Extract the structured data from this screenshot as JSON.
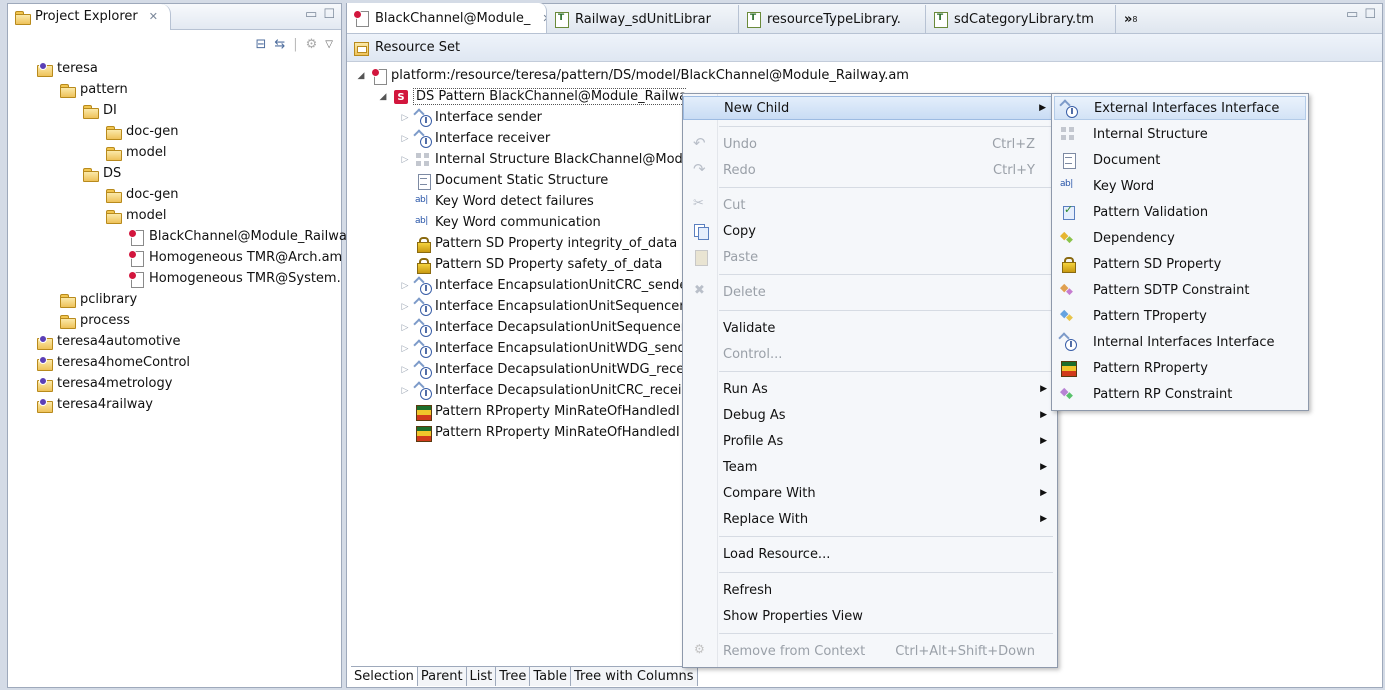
{
  "explorer": {
    "title": "Project Explorer",
    "tree": [
      {
        "label": "teresa",
        "icon": "project-icon",
        "depth": 0
      },
      {
        "label": "pattern",
        "icon": "folder-icon",
        "depth": 1
      },
      {
        "label": "DI",
        "icon": "folder-icon",
        "depth": 2
      },
      {
        "label": "doc-gen",
        "icon": "folder-icon",
        "depth": 3
      },
      {
        "label": "model",
        "icon": "folder-icon",
        "depth": 3
      },
      {
        "label": "DS",
        "icon": "folder-icon",
        "depth": 2
      },
      {
        "label": "doc-gen",
        "icon": "folder-icon",
        "depth": 3
      },
      {
        "label": "model",
        "icon": "folder-icon",
        "depth": 3
      },
      {
        "label": "BlackChannel@Module_Railwa",
        "icon": "model-file-icon",
        "depth": 4
      },
      {
        "label": "Homogeneous TMR@Arch.am",
        "icon": "model-file-icon",
        "depth": 4
      },
      {
        "label": "Homogeneous TMR@System.",
        "icon": "model-file-icon",
        "depth": 4
      },
      {
        "label": "pclibrary",
        "icon": "folder-icon",
        "depth": 1
      },
      {
        "label": "process",
        "icon": "folder-icon",
        "depth": 1
      },
      {
        "label": "teresa4automotive",
        "icon": "project-icon",
        "depth": 0
      },
      {
        "label": "teresa4homeControl",
        "icon": "project-icon",
        "depth": 0
      },
      {
        "label": "teresa4metrology",
        "icon": "project-icon",
        "depth": 0
      },
      {
        "label": "teresa4railway",
        "icon": "project-icon",
        "depth": 0
      }
    ]
  },
  "editor": {
    "tabs": [
      {
        "label": "BlackChannel@Module_",
        "active": true
      },
      {
        "label": "Railway_sdUnitLibrar",
        "active": false
      },
      {
        "label": "resourceTypeLibrary.",
        "active": false
      },
      {
        "label": "sdCategoryLibrary.tm",
        "active": false
      }
    ],
    "overflow_label": "»",
    "overflow_count": "8",
    "header": "Resource Set",
    "root": "platform:/resource/teresa/pattern/DS/model/BlackChannel@Module_Railway.am",
    "pattern": "DS Pattern BlackChannel@Module_Railwa",
    "items": [
      {
        "label": "Interface sender",
        "icon": "interface-icon",
        "expand": true
      },
      {
        "label": "Interface receiver",
        "icon": "interface-icon",
        "expand": true
      },
      {
        "label": "Internal Structure BlackChannel@Mod",
        "icon": "structure-icon",
        "expand": true
      },
      {
        "label": "Document Static Structure",
        "icon": "document-icon",
        "expand": false
      },
      {
        "label": "Key Word detect failures",
        "icon": "keyword-icon",
        "expand": false
      },
      {
        "label": "Key Word communication",
        "icon": "keyword-icon",
        "expand": false
      },
      {
        "label": "Pattern SD Property integrity_of_data",
        "icon": "lock-icon",
        "expand": false
      },
      {
        "label": "Pattern SD Property safety_of_data",
        "icon": "lock-icon",
        "expand": false
      },
      {
        "label": "Interface EncapsulationUnitCRC_sende",
        "icon": "interface-icon",
        "expand": true
      },
      {
        "label": "Interface EncapsulationUnitSequencer_",
        "icon": "interface-icon",
        "expand": true
      },
      {
        "label": "Interface DecapsulationUnitSequencer_",
        "icon": "interface-icon",
        "expand": true
      },
      {
        "label": "Interface EncapsulationUnitWDG_send",
        "icon": "interface-icon",
        "expand": true
      },
      {
        "label": "Interface DecapsulationUnitWDG_recei",
        "icon": "interface-icon",
        "expand": true
      },
      {
        "label": "Interface DecapsulationUnitCRC_receiv",
        "icon": "interface-icon",
        "expand": true
      },
      {
        "label": "Pattern RProperty MinRateOfHandledI",
        "icon": "rproperty-icon",
        "expand": false
      },
      {
        "label": "Pattern RProperty MinRateOfHandledI",
        "icon": "rproperty-icon",
        "expand": false
      }
    ],
    "bottom_tabs": [
      "Selection",
      "Parent",
      "List",
      "Tree",
      "Table",
      "Tree with Columns"
    ]
  },
  "context_menu": {
    "items": [
      {
        "label": "New Child",
        "icon": "",
        "key": "",
        "arrow": true,
        "disabled": false,
        "highlight": true
      },
      {
        "label": "Undo",
        "icon": "undo-icon",
        "key": "Ctrl+Z",
        "arrow": false,
        "disabled": true
      },
      {
        "label": "Redo",
        "icon": "redo-icon",
        "key": "Ctrl+Y",
        "arrow": false,
        "disabled": true
      },
      {
        "label": "Cut",
        "icon": "cut-icon",
        "key": "",
        "arrow": false,
        "disabled": true
      },
      {
        "label": "Copy",
        "icon": "copy-icon",
        "key": "",
        "arrow": false,
        "disabled": false
      },
      {
        "label": "Paste",
        "icon": "paste-icon",
        "key": "",
        "arrow": false,
        "disabled": true
      },
      {
        "label": "Delete",
        "icon": "delete-icon",
        "key": "",
        "arrow": false,
        "disabled": true
      },
      {
        "label": "Validate",
        "icon": "",
        "key": "",
        "arrow": false,
        "disabled": false
      },
      {
        "label": "Control...",
        "icon": "",
        "key": "",
        "arrow": false,
        "disabled": true
      },
      {
        "label": "Run As",
        "icon": "",
        "key": "",
        "arrow": true,
        "disabled": false
      },
      {
        "label": "Debug As",
        "icon": "",
        "key": "",
        "arrow": true,
        "disabled": false
      },
      {
        "label": "Profile As",
        "icon": "",
        "key": "",
        "arrow": true,
        "disabled": false
      },
      {
        "label": "Team",
        "icon": "",
        "key": "",
        "arrow": true,
        "disabled": false
      },
      {
        "label": "Compare With",
        "icon": "",
        "key": "",
        "arrow": true,
        "disabled": false
      },
      {
        "label": "Replace With",
        "icon": "",
        "key": "",
        "arrow": true,
        "disabled": false
      },
      {
        "label": "Load Resource...",
        "icon": "",
        "key": "",
        "arrow": false,
        "disabled": false
      },
      {
        "label": "Refresh",
        "icon": "",
        "key": "",
        "arrow": false,
        "disabled": false
      },
      {
        "label": "Show Properties View",
        "icon": "",
        "key": "",
        "arrow": false,
        "disabled": false
      },
      {
        "label": "Remove from Context",
        "icon": "remove-context-icon",
        "key": "Ctrl+Alt+Shift+Down",
        "arrow": false,
        "disabled": true
      }
    ]
  },
  "submenu": {
    "items": [
      {
        "label": "External Interfaces Interface",
        "icon": "interface-icon"
      },
      {
        "label": "Internal Structure",
        "icon": "structure-icon"
      },
      {
        "label": "Document",
        "icon": "document-icon"
      },
      {
        "label": "Key Word",
        "icon": "keyword-icon"
      },
      {
        "label": "Pattern Validation",
        "icon": "validation-icon"
      },
      {
        "label": "Dependency",
        "icon": "dependency-icon"
      },
      {
        "label": "Pattern SD Property",
        "icon": "lock-icon"
      },
      {
        "label": "Pattern SDTP Constraint",
        "icon": "sdtp-constraint-icon"
      },
      {
        "label": "Pattern TProperty",
        "icon": "tproperty-icon"
      },
      {
        "label": "Internal Interfaces Interface",
        "icon": "interface-icon"
      },
      {
        "label": "Pattern RProperty",
        "icon": "rproperty-icon"
      },
      {
        "label": "Pattern RP Constraint",
        "icon": "rp-constraint-icon"
      }
    ]
  }
}
